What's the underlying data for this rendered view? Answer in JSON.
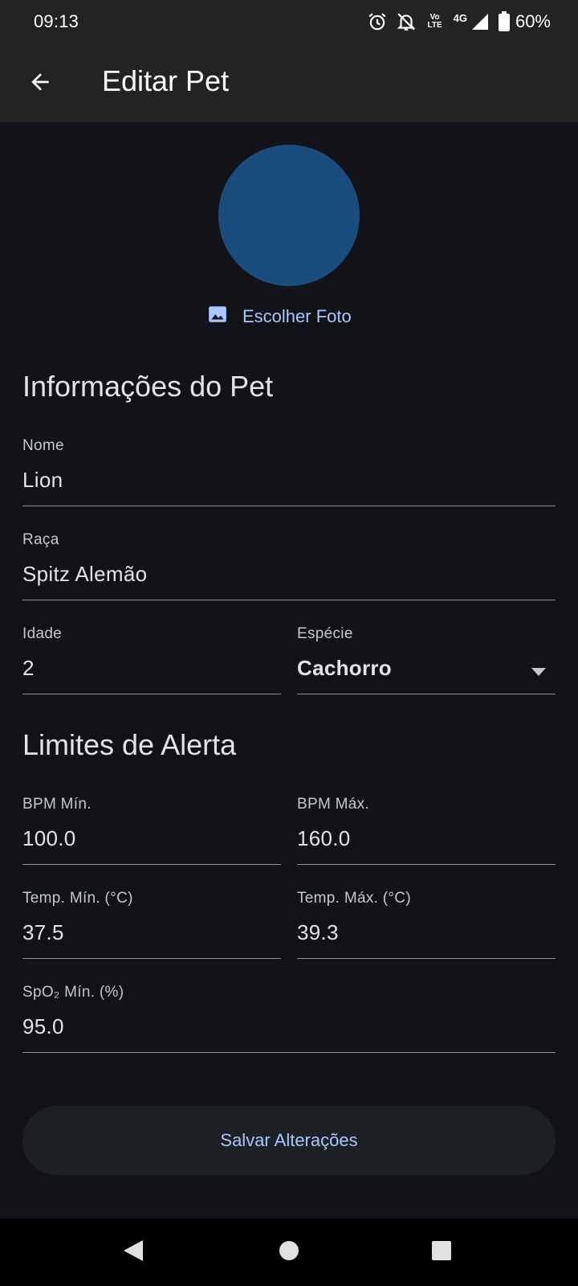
{
  "status_bar": {
    "time": "09:13",
    "lte_top": "Vo",
    "lte_bottom": "LTE",
    "network_type": "4G",
    "battery": "60%",
    "icons": [
      "alarm-icon",
      "bell-off-icon",
      "volte-icon",
      "signal-icon",
      "battery-icon"
    ]
  },
  "app_bar": {
    "title": "Editar Pet",
    "back_icon": "arrow-back-icon"
  },
  "photo": {
    "avatar_color": "#1b4c7e",
    "choose_label": "Escolher Foto",
    "icon": "image-icon"
  },
  "pet_info": {
    "title": "Informações do Pet",
    "name": {
      "label": "Nome",
      "value": "Lion"
    },
    "breed": {
      "label": "Raça",
      "value": "Spitz Alemão"
    },
    "age": {
      "label": "Idade",
      "value": "2"
    },
    "species": {
      "label": "Espécie",
      "value": "Cachorro",
      "icon": "arrow-drop-down-icon"
    }
  },
  "alert_limits": {
    "title": "Limites de Alerta",
    "bpm_min": {
      "label": "BPM Mín.",
      "value": "100.0"
    },
    "bpm_max": {
      "label": "BPM Máx.",
      "value": "160.0"
    },
    "temp_min": {
      "label": "Temp. Mín. (°C)",
      "value": "37.5"
    },
    "temp_max": {
      "label": "Temp. Máx. (°C)",
      "value": "39.3"
    },
    "spo2_min": {
      "label": "SpO₂ Mín. (%)",
      "value": "95.0"
    }
  },
  "save_button": {
    "label": "Salvar Alterações"
  },
  "nav_bar": {
    "icons": [
      "back-triangle-icon",
      "home-circle-icon",
      "recents-square-icon"
    ]
  },
  "colors": {
    "background": "#111318",
    "bars": "#232323",
    "accent": "#a8c8ff",
    "avatar": "#1b4c7e",
    "button": "#1d2024"
  }
}
